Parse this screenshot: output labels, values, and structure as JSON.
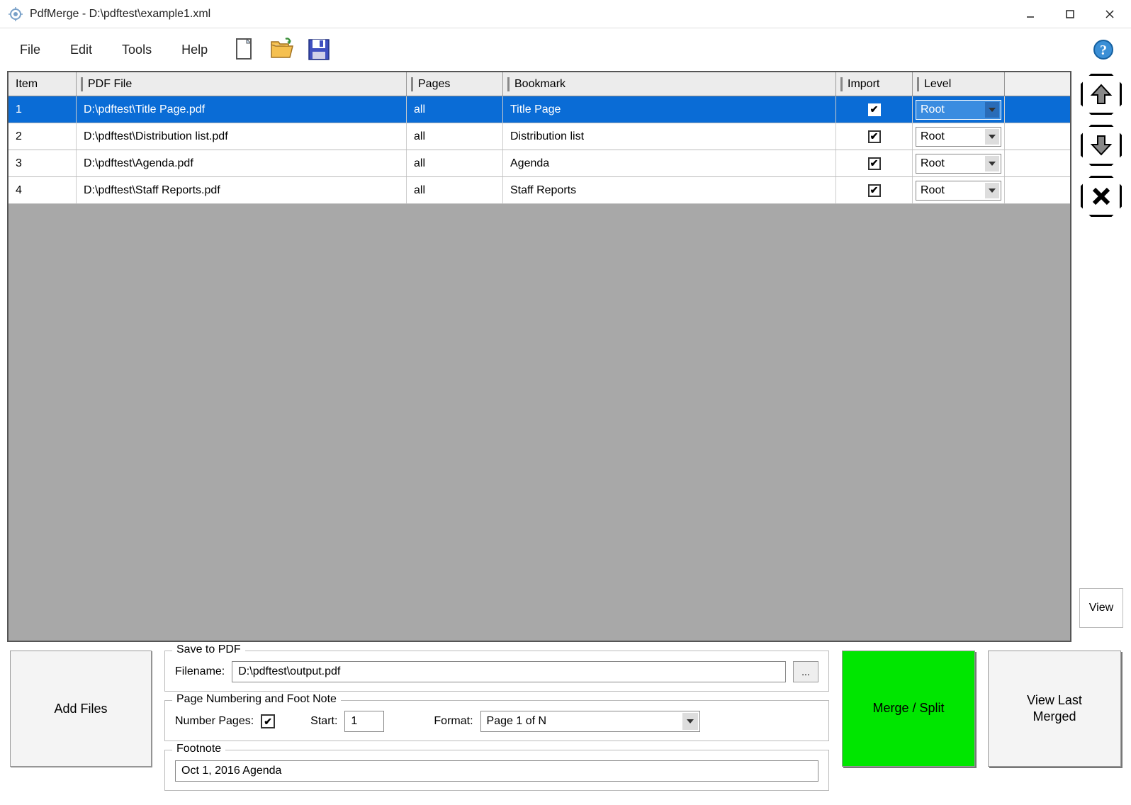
{
  "window": {
    "title": "PdfMerge - D:\\pdftest\\example1.xml"
  },
  "menu": {
    "file": "File",
    "edit": "Edit",
    "tools": "Tools",
    "help": "Help"
  },
  "table": {
    "headers": {
      "item": "Item",
      "file": "PDF File",
      "pages": "Pages",
      "bookmark": "Bookmark",
      "import": "Import",
      "level": "Level"
    },
    "rows": [
      {
        "item": "1",
        "file": "D:\\pdftest\\Title Page.pdf",
        "pages": "all",
        "bookmark": "Title Page",
        "import": true,
        "level": "Root",
        "selected": true
      },
      {
        "item": "2",
        "file": "D:\\pdftest\\Distribution list.pdf",
        "pages": "all",
        "bookmark": "Distribution list",
        "import": true,
        "level": "Root",
        "selected": false
      },
      {
        "item": "3",
        "file": "D:\\pdftest\\Agenda.pdf",
        "pages": "all",
        "bookmark": "Agenda",
        "import": true,
        "level": "Root",
        "selected": false
      },
      {
        "item": "4",
        "file": "D:\\pdftest\\Staff Reports.pdf",
        "pages": "all",
        "bookmark": "Staff Reports",
        "import": true,
        "level": "Root",
        "selected": false
      }
    ]
  },
  "side": {
    "view": "View"
  },
  "bottom": {
    "add_files": "Add Files",
    "save_group": "Save to PDF",
    "filename_label": "Filename:",
    "filename_value": "D:\\pdftest\\output.pdf",
    "browse_label": "...",
    "numbering_group": "Page Numbering and Foot Note",
    "number_pages_label": "Number Pages:",
    "number_pages_checked": true,
    "start_label": "Start:",
    "start_value": "1",
    "format_label": "Format:",
    "format_value": "Page 1 of N",
    "footnote_group": "Footnote",
    "footnote_value": "Oct 1, 2016 Agenda",
    "merge": "Merge / Split",
    "view_last": "View Last\nMerged"
  }
}
